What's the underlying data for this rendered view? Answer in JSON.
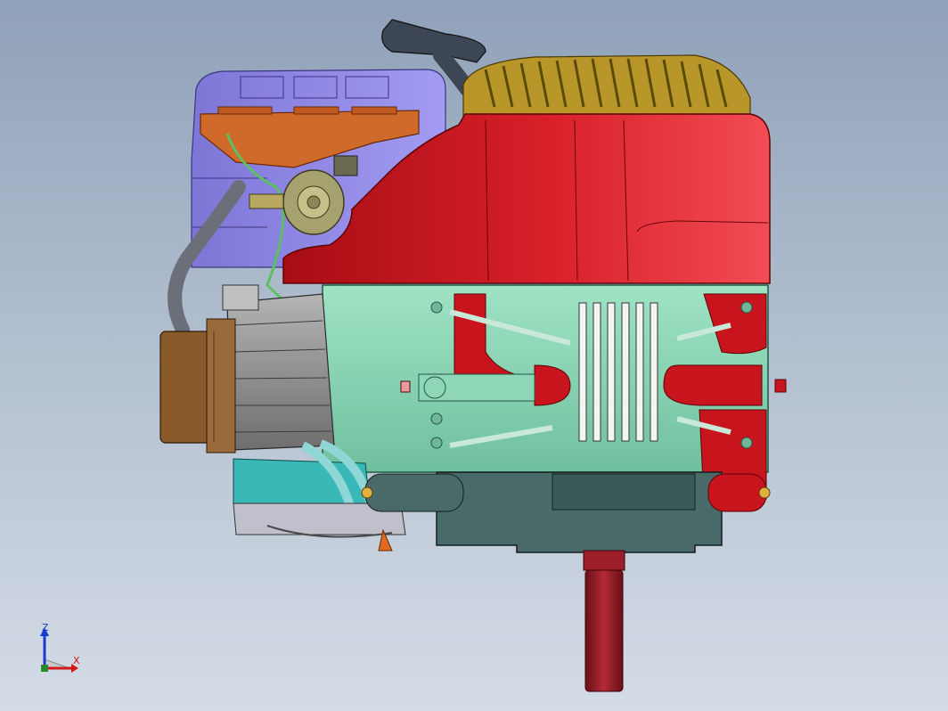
{
  "viewport": {
    "background_top": "#8fa1b9",
    "background_bottom": "#d4dce6"
  },
  "model": {
    "parts": [
      {
        "name": "recoil-starter-handle",
        "color": "#3d4654"
      },
      {
        "name": "flywheel-screen",
        "color": "#b8962a"
      },
      {
        "name": "blower-housing",
        "color": "#c8141c"
      },
      {
        "name": "air-filter-cover",
        "color": "#8f88e6"
      },
      {
        "name": "air-filter-base",
        "color": "#d06a2a"
      },
      {
        "name": "carburetor",
        "color": "#a6a270"
      },
      {
        "name": "cylinder-head",
        "color": "#8c8c8c"
      },
      {
        "name": "muffler",
        "color": "#8a5a2a"
      },
      {
        "name": "crankcase-section",
        "color": "#8fd6b6"
      },
      {
        "name": "oil-sump",
        "color": "#4a6a6a"
      },
      {
        "name": "crankshaft-pto",
        "color": "#8c1a24"
      },
      {
        "name": "fuel-line",
        "color": "#6a6f7a"
      },
      {
        "name": "base-bracket",
        "color": "#3ab8b8"
      }
    ]
  },
  "triad": {
    "z_label": "Z",
    "x_label": "X",
    "z_color": "#1a3ad0",
    "x_color": "#d01a1a"
  }
}
